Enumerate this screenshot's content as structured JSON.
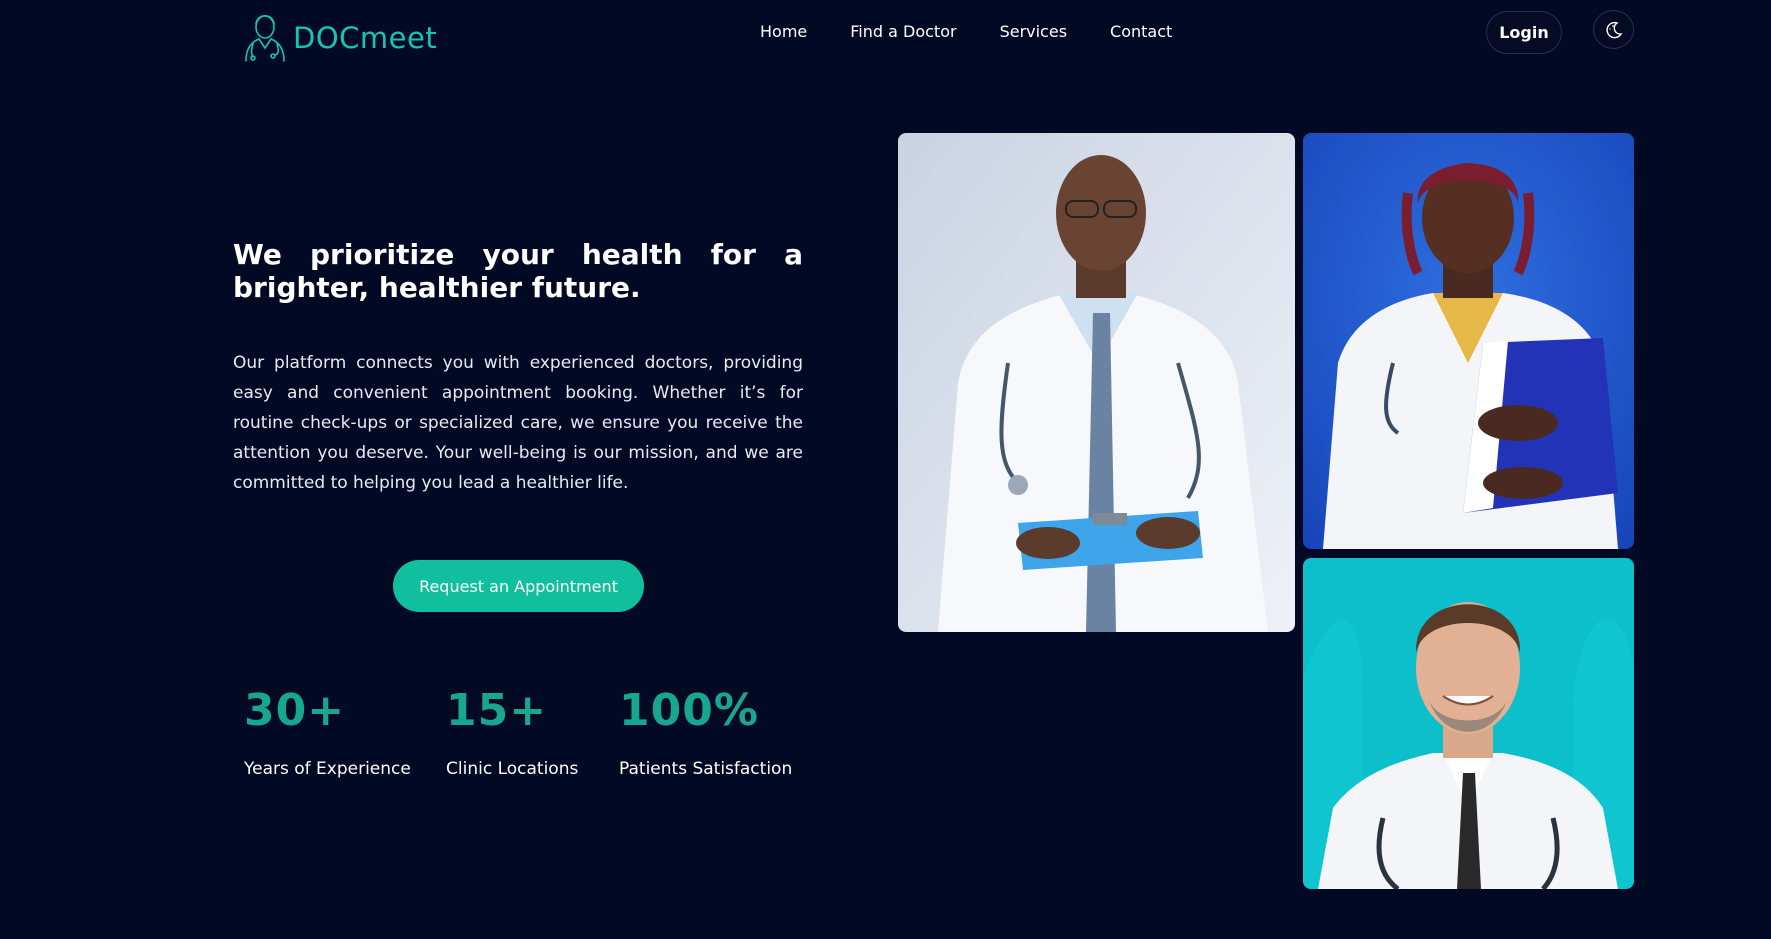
{
  "brand": {
    "name": "DOCmeet",
    "color": "#17c4b3"
  },
  "nav": {
    "items": [
      {
        "label": "Home"
      },
      {
        "label": "Find a Doctor"
      },
      {
        "label": "Services"
      },
      {
        "label": "Contact"
      }
    ]
  },
  "header": {
    "login_label": "Login",
    "theme_toggle_icon": "moon-icon"
  },
  "hero": {
    "headline": "We prioritize your health for a brighter, healthier future.",
    "description": "Our platform connects you with experienced doctors, providing easy and convenient appointment booking. Whether it’s for routine check-ups or specialized care, we ensure you receive the attention you deserve. Your well-being is our mission, and we are committed to helping you lead a healthier life.",
    "cta_label": "Request an Appointment"
  },
  "stats": [
    {
      "value": "30+",
      "label": "Years of Experience"
    },
    {
      "value": "15+",
      "label": "Clinic Locations"
    },
    {
      "value": "100%",
      "label": "Patients Satisfaction"
    }
  ],
  "colors": {
    "background": "#020924",
    "accent": "#0fbf9f",
    "stat": "#17a68f"
  }
}
